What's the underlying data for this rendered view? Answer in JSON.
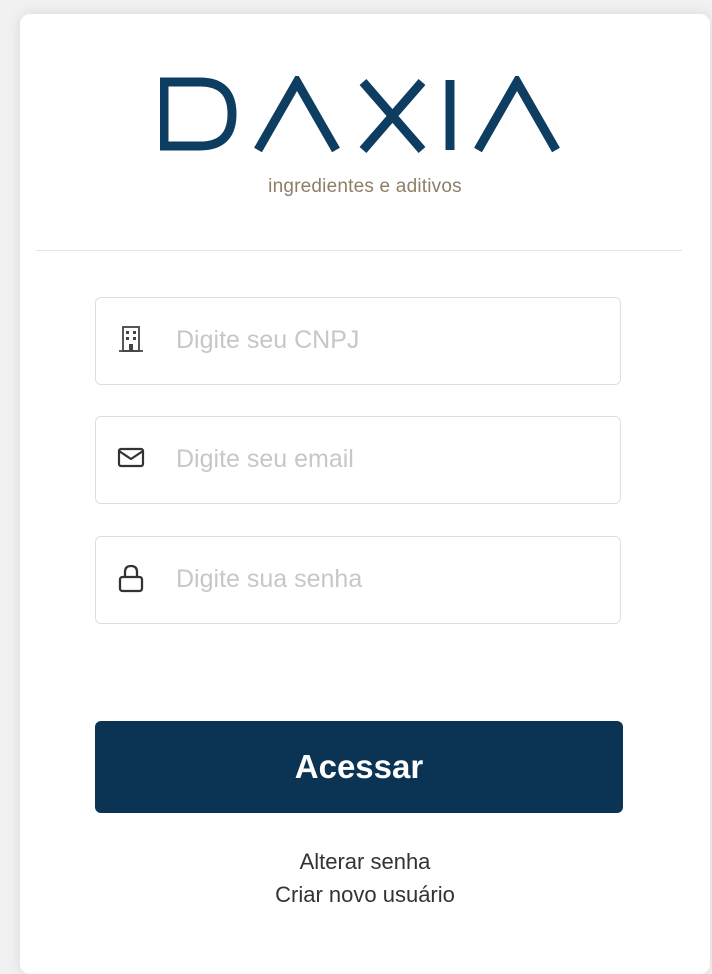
{
  "brand": {
    "name": "DAXIA",
    "tagline": "ingredientes e aditivos",
    "logo_color": "#0d3e62",
    "tagline_color": "#8d7f66"
  },
  "form": {
    "cnpj": {
      "placeholder": "Digite seu CNPJ",
      "value": "",
      "icon": "building-icon"
    },
    "email": {
      "placeholder": "Digite seu email",
      "value": "",
      "icon": "envelope-icon"
    },
    "password": {
      "placeholder": "Digite sua senha",
      "value": "",
      "icon": "lock-icon"
    },
    "submit_label": "Acessar",
    "submit_color": "#0b3354"
  },
  "links": {
    "change_password": "Alterar senha",
    "create_user": "Criar novo usuário"
  }
}
